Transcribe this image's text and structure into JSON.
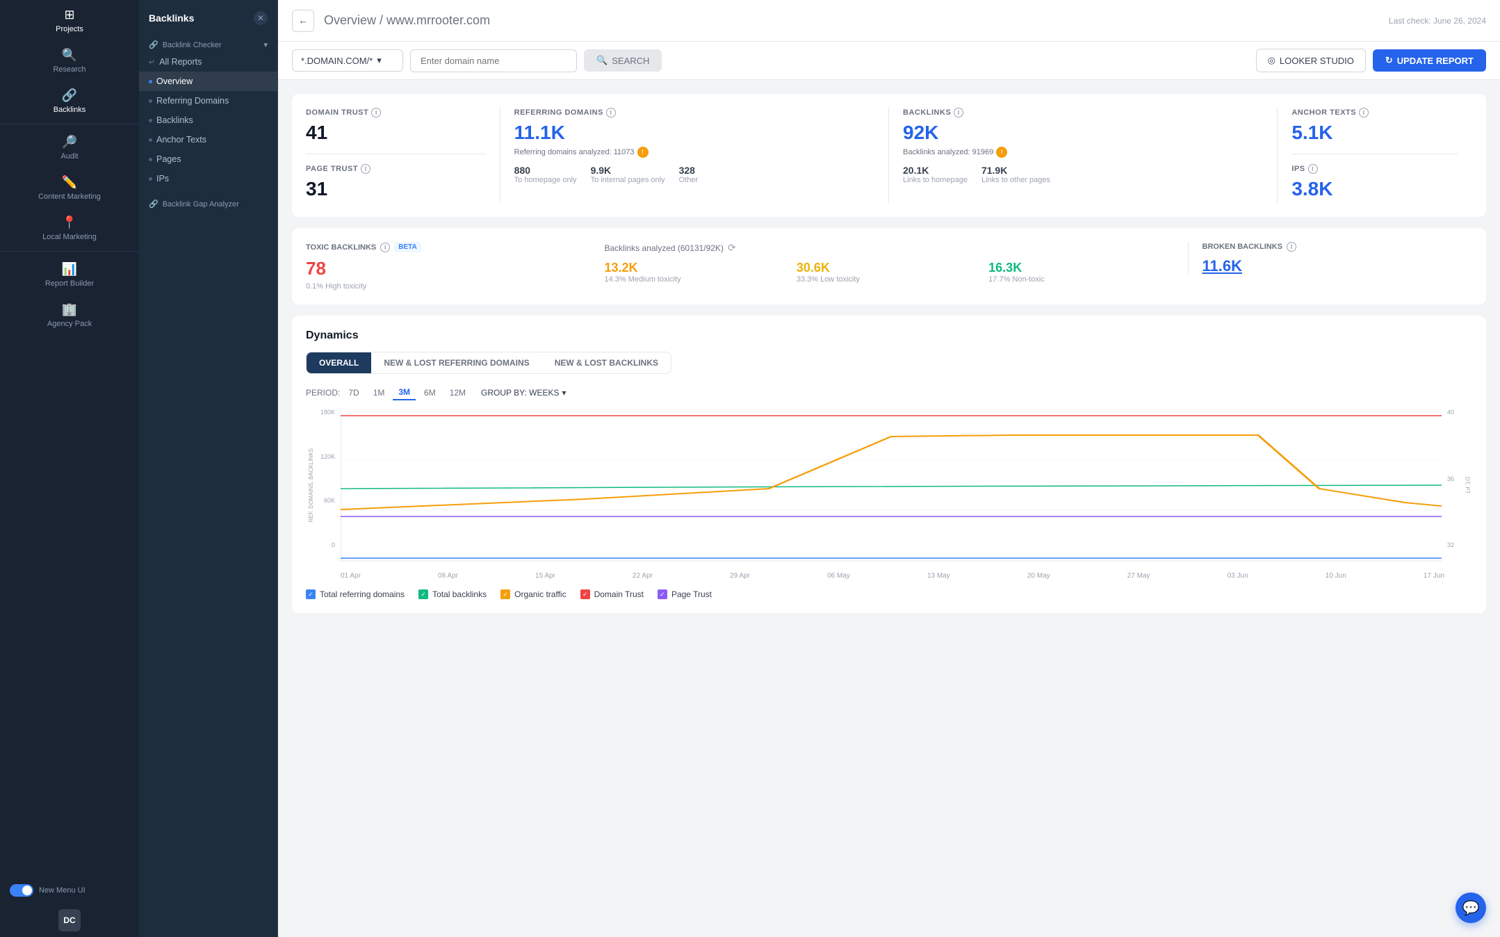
{
  "app": {
    "title": "Backlinks"
  },
  "sidebar": {
    "items": [
      {
        "id": "projects",
        "label": "Projects",
        "icon": "⊞"
      },
      {
        "id": "research",
        "label": "Research",
        "icon": "🔍"
      },
      {
        "id": "backlinks",
        "label": "Backlinks",
        "icon": "🔗"
      },
      {
        "id": "audit",
        "label": "Audit",
        "icon": "🔎"
      },
      {
        "id": "content-marketing",
        "label": "Content Marketing",
        "icon": "✏️"
      },
      {
        "id": "local-marketing",
        "label": "Local Marketing",
        "icon": "📍"
      },
      {
        "id": "report-builder",
        "label": "Report Builder",
        "icon": "📊"
      },
      {
        "id": "agency-pack",
        "label": "Agency Pack",
        "icon": "🏢"
      }
    ]
  },
  "backlinks_panel": {
    "title": "Backlinks",
    "sections": [
      {
        "label": "Backlink Checker",
        "items": [
          {
            "id": "all-reports",
            "label": "All Reports",
            "active": false
          },
          {
            "id": "overview",
            "label": "Overview",
            "active": true
          },
          {
            "id": "referring-domains",
            "label": "Referring Domains",
            "active": false
          },
          {
            "id": "backlinks",
            "label": "Backlinks",
            "active": false
          },
          {
            "id": "anchor-texts",
            "label": "Anchor Texts",
            "active": false
          },
          {
            "id": "pages",
            "label": "Pages",
            "active": false
          },
          {
            "id": "ips",
            "label": "IPs",
            "active": false
          }
        ]
      },
      {
        "label": "Backlink Gap Analyzer",
        "items": []
      }
    ]
  },
  "header": {
    "title": "Overview / www.mrrooter.com",
    "title_prefix": "Overview / ",
    "title_domain": "www.mrrooter.com",
    "last_check": "Last check: June 26, 2024",
    "back_label": "←"
  },
  "toolbar": {
    "domain_selector": "*.DOMAIN.COM/*",
    "domain_selector_chevron": "▾",
    "search_placeholder": "Enter domain name",
    "search_label": "SEARCH",
    "looker_label": "LOOKER STUDIO",
    "update_label": "UPDATE REPORT"
  },
  "stats": {
    "domain_trust": {
      "label": "DOMAIN TRUST",
      "value": "41"
    },
    "page_trust": {
      "label": "PAGE TRUST",
      "value": "31"
    },
    "referring_domains": {
      "label": "REFERRING DOMAINS",
      "value": "11.1K",
      "analyzed_text": "Referring domains analyzed: 11073",
      "sub_items": [
        {
          "value": "880",
          "label": "To homepage only"
        },
        {
          "value": "9.9K",
          "label": "To internal pages only"
        },
        {
          "value": "328",
          "label": "Other"
        }
      ]
    },
    "backlinks": {
      "label": "BACKLINKS",
      "value": "92K",
      "analyzed_text": "Backlinks analyzed: 91969",
      "sub_items": [
        {
          "value": "20.1K",
          "label": "Links to homepage"
        },
        {
          "value": "71.9K",
          "label": "Links to other pages"
        }
      ]
    },
    "anchor_texts": {
      "label": "ANCHOR TEXTS",
      "value": "5.1K"
    },
    "ips": {
      "label": "IPS",
      "value": "3.8K"
    }
  },
  "toxic": {
    "label": "TOXIC BACKLINKS",
    "beta_label": "BETA",
    "analyzed_text": "Backlinks analyzed (60131/92K)",
    "high": {
      "value": "78",
      "label": "0.1% High toxicity"
    },
    "medium": {
      "value": "13.2K",
      "label": "14.3% Medium toxicity"
    },
    "low": {
      "value": "30.6K",
      "label": "33.3% Low toxicity"
    },
    "nontoxic": {
      "value": "16.3K",
      "label": "17.7% Non-toxic"
    }
  },
  "broken": {
    "label": "BROKEN BACKLINKS",
    "value": "11.6K"
  },
  "dynamics": {
    "title": "Dynamics",
    "tabs": [
      {
        "id": "overall",
        "label": "OVERALL",
        "active": true
      },
      {
        "id": "new-lost-referring",
        "label": "NEW & LOST REFERRING DOMAINS",
        "active": false
      },
      {
        "id": "new-lost-backlinks",
        "label": "NEW & LOST BACKLINKS",
        "active": false
      }
    ],
    "period_label": "PERIOD:",
    "periods": [
      {
        "id": "7d",
        "label": "7D",
        "active": false
      },
      {
        "id": "1m",
        "label": "1M",
        "active": false
      },
      {
        "id": "3m",
        "label": "3M",
        "active": true
      },
      {
        "id": "6m",
        "label": "6M",
        "active": false
      },
      {
        "id": "12m",
        "label": "12M",
        "active": false
      }
    ],
    "group_by": "GROUP BY: WEEKS",
    "y_left_labels": [
      "180K",
      "120K",
      "60K",
      "0"
    ],
    "y_right_labels": [
      "40",
      "36",
      "32"
    ],
    "y_left_axis_label": "REF. DOMAINS, BACKLINKS",
    "y_right_axis_label": "DT, PT",
    "x_labels": [
      "01 Apr",
      "08 Apr",
      "15 Apr",
      "22 Apr",
      "29 Apr",
      "06 May",
      "13 May",
      "20 May",
      "27 May",
      "03 Jun",
      "10 Jun",
      "17 Jun"
    ],
    "legend": [
      {
        "id": "total-referring",
        "label": "Total referring domains",
        "color": "#3b82f6",
        "type": "check"
      },
      {
        "id": "total-backlinks",
        "label": "Total backlinks",
        "color": "#10b981",
        "type": "check"
      },
      {
        "id": "organic-traffic",
        "label": "Organic traffic",
        "color": "#f59e0b",
        "type": "check"
      },
      {
        "id": "domain-trust",
        "label": "Domain Trust",
        "color": "#ef4444",
        "type": "check"
      },
      {
        "id": "page-trust",
        "label": "Page Trust",
        "color": "#8b5cf6",
        "type": "check"
      }
    ]
  },
  "toggle": {
    "label": "New Menu UI"
  },
  "user": {
    "initials": "DC"
  },
  "chat_icon": "💬"
}
